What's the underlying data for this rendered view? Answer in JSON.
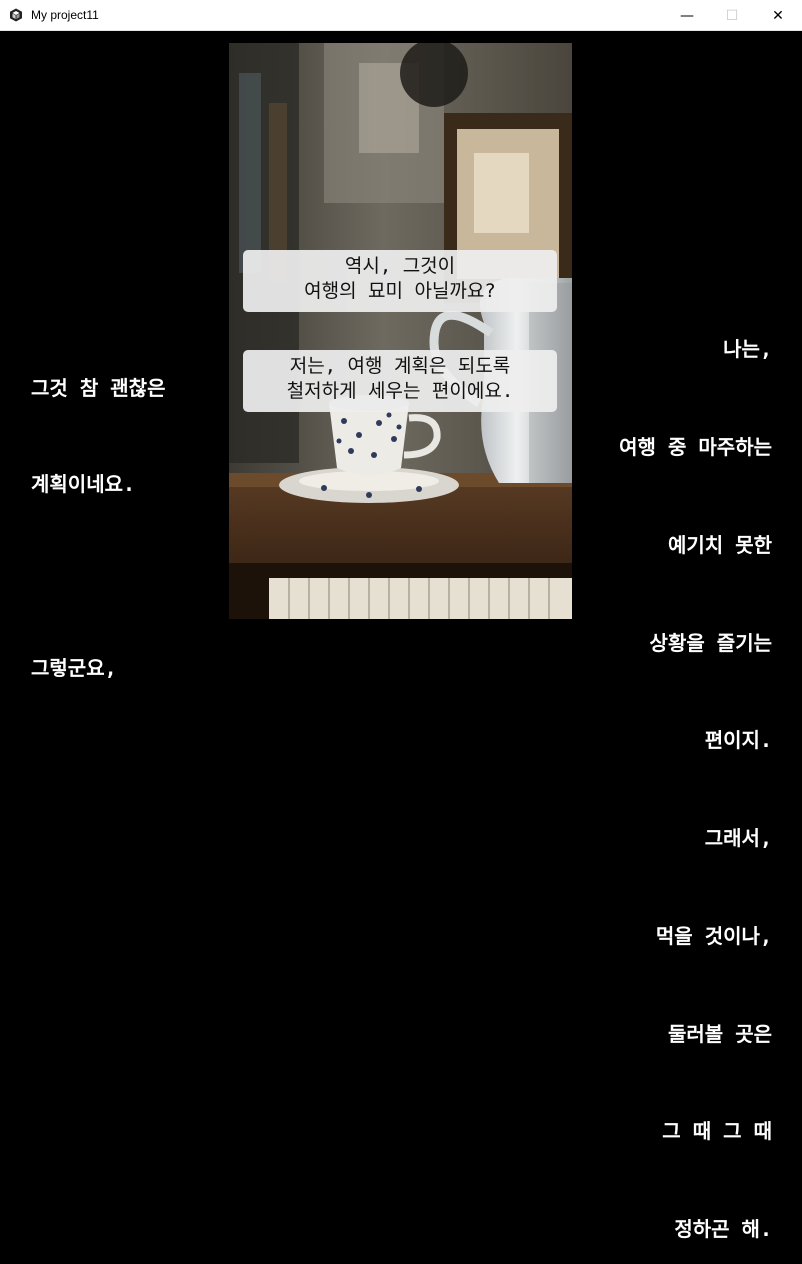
{
  "window": {
    "title": "My project11",
    "minimize_glyph": "—",
    "maximize_glyph": "☐",
    "close_glyph": "✕"
  },
  "dialogue_center": [
    {
      "lines": [
        "역시, 그것이",
        "여행의 묘미 아닐까요?"
      ]
    },
    {
      "lines": [
        "저는, 여행 계획은 되도록",
        "철저하게 세우는 편이에요."
      ]
    }
  ],
  "dialogue_left": {
    "block1": [
      "그것 참 괜찮은",
      "계획이네요."
    ],
    "block2": [
      "그렇군요,"
    ]
  },
  "dialogue_right": {
    "lines": [
      "나는,",
      "여행 중 마주하는",
      "예기치 못한",
      "상황을 즐기는",
      "편이지.",
      "그래서,",
      "먹을 것이나,",
      "둘러볼 곳은",
      "그 때 그 때",
      "정하곤 해."
    ]
  },
  "colors": {
    "background": "#000000",
    "text_side": "#ffffff",
    "bubble": "#eeeeee",
    "bubble_text": "#111111"
  },
  "icons": {
    "app": "unity-cube-icon",
    "minimize": "minimize-icon",
    "maximize": "maximize-icon",
    "close": "close-icon"
  }
}
